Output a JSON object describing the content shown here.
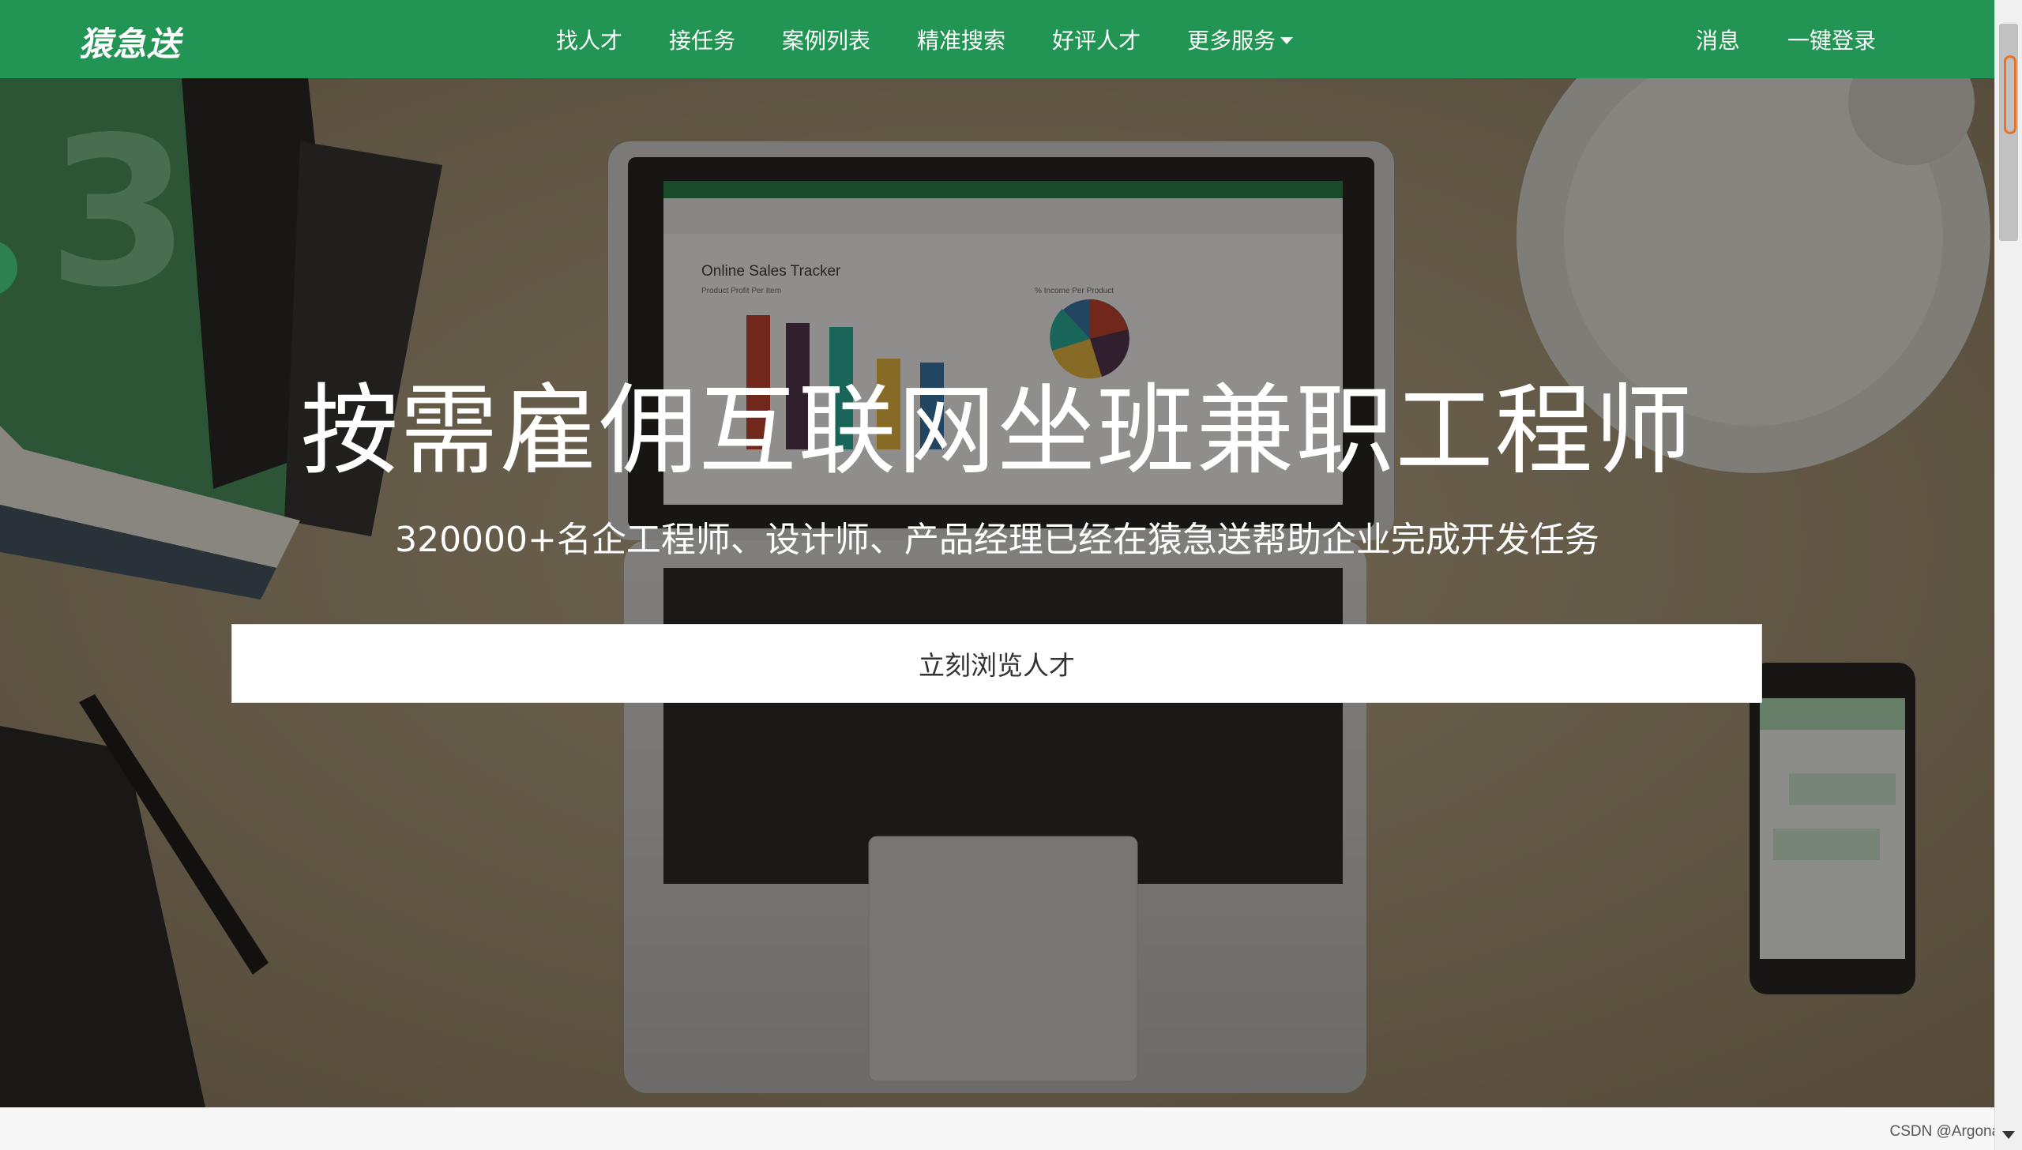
{
  "navbar": {
    "brand": "猿急送",
    "links": [
      "找人才",
      "接任务",
      "案例列表",
      "精准搜索",
      "好评人才",
      "更多服务"
    ],
    "right_links": [
      "消息",
      "一键登录"
    ],
    "color": "#229453"
  },
  "hero": {
    "title": "按需雇佣互联网坐班兼职工程师",
    "subtitle": "320000+名企工程师、设计师、产品经理已经在猿急送帮助企业完成开发任务",
    "cta_label": "立刻浏览人才",
    "screen": {
      "sheet_title": "Online Sales Tracker",
      "sheet_subtitle": "Product Profit Per Item",
      "pie_title": "% Income Per Product"
    }
  },
  "footer": {
    "watermark": "CSDN @Argonaut"
  }
}
